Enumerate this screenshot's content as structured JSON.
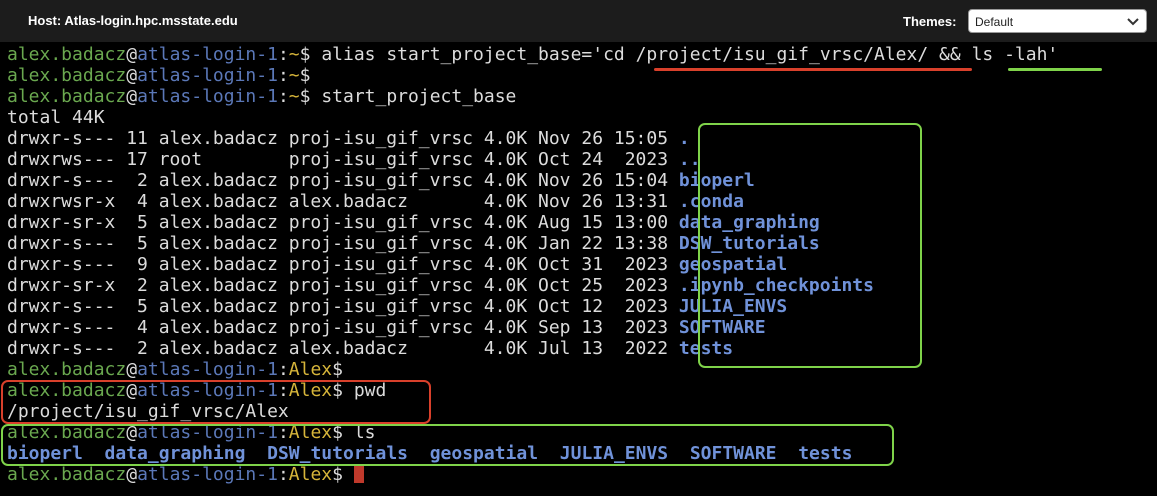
{
  "header": {
    "host": "Host: Atlas-login.hpc.msstate.edu",
    "themes_label": "Themes:",
    "theme_value": "Default"
  },
  "colors": {
    "user": "#6aa84f",
    "host": "#5b78b8",
    "path": "#d6b53a",
    "directory": "#7092d9",
    "annotation_red": "#d9402b",
    "annotation_green": "#7fd34a"
  },
  "terminal": {
    "user": "alex.badacz",
    "at": "@",
    "hostname": "atlas-login-1",
    "sep": ":",
    "home": "~",
    "dir": "Alex",
    "prompt_char": "$",
    "cmd1_pre": " alias start_project_base='cd ",
    "cmd1_path": "/project/isu_gif_vrsc/Alex/",
    "cmd1_mid": " && ",
    "cmd1_ls": "ls -lah",
    "cmd1_post": "'",
    "cmd2": "",
    "cmd3": " start_project_base",
    "total": "total 44K",
    "listing": [
      {
        "info": "drwxr-s--- 11 alex.badacz proj-isu_gif_vrsc 4.0K Nov 26 15:05 ",
        "name": "."
      },
      {
        "info": "drwxrws--- 17 root        proj-isu_gif_vrsc 4.0K Oct 24  2023 ",
        "name": ".."
      },
      {
        "info": "drwxr-s---  2 alex.badacz proj-isu_gif_vrsc 4.0K Nov 26 15:04 ",
        "name": "bioperl"
      },
      {
        "info": "drwxrwsr-x  4 alex.badacz alex.badacz       4.0K Nov 26 13:31 ",
        "name": ".conda"
      },
      {
        "info": "drwxr-sr-x  5 alex.badacz proj-isu_gif_vrsc 4.0K Aug 15 13:00 ",
        "name": "data_graphing"
      },
      {
        "info": "drwxr-s---  5 alex.badacz proj-isu_gif_vrsc 4.0K Jan 22 13:38 ",
        "name": "DSW_tutorials"
      },
      {
        "info": "drwxr-s---  9 alex.badacz proj-isu_gif_vrsc 4.0K Oct 31  2023 ",
        "name": "geospatial"
      },
      {
        "info": "drwxr-sr-x  2 alex.badacz proj-isu_gif_vrsc 4.0K Oct 25  2023 ",
        "name": ".ipynb_checkpoints"
      },
      {
        "info": "drwxr-s---  5 alex.badacz proj-isu_gif_vrsc 4.0K Oct 12  2023 ",
        "name": "JULIA_ENVS"
      },
      {
        "info": "drwxr-s---  4 alex.badacz proj-isu_gif_vrsc 4.0K Sep 13  2023 ",
        "name": "SOFTWARE"
      },
      {
        "info": "drwxr-s---  2 alex.badacz alex.badacz       4.0K Jul 13  2022 ",
        "name": "tests"
      }
    ],
    "cmd4": "",
    "cmd5": " pwd",
    "pwd_output": "/project/isu_gif_vrsc/Alex",
    "cmd6": " ls",
    "ls_output": [
      "bioperl",
      "data_graphing",
      "DSW_tutorials",
      "geospatial",
      "JULIA_ENVS",
      "SOFTWARE",
      "tests"
    ],
    "cmd7": " "
  }
}
